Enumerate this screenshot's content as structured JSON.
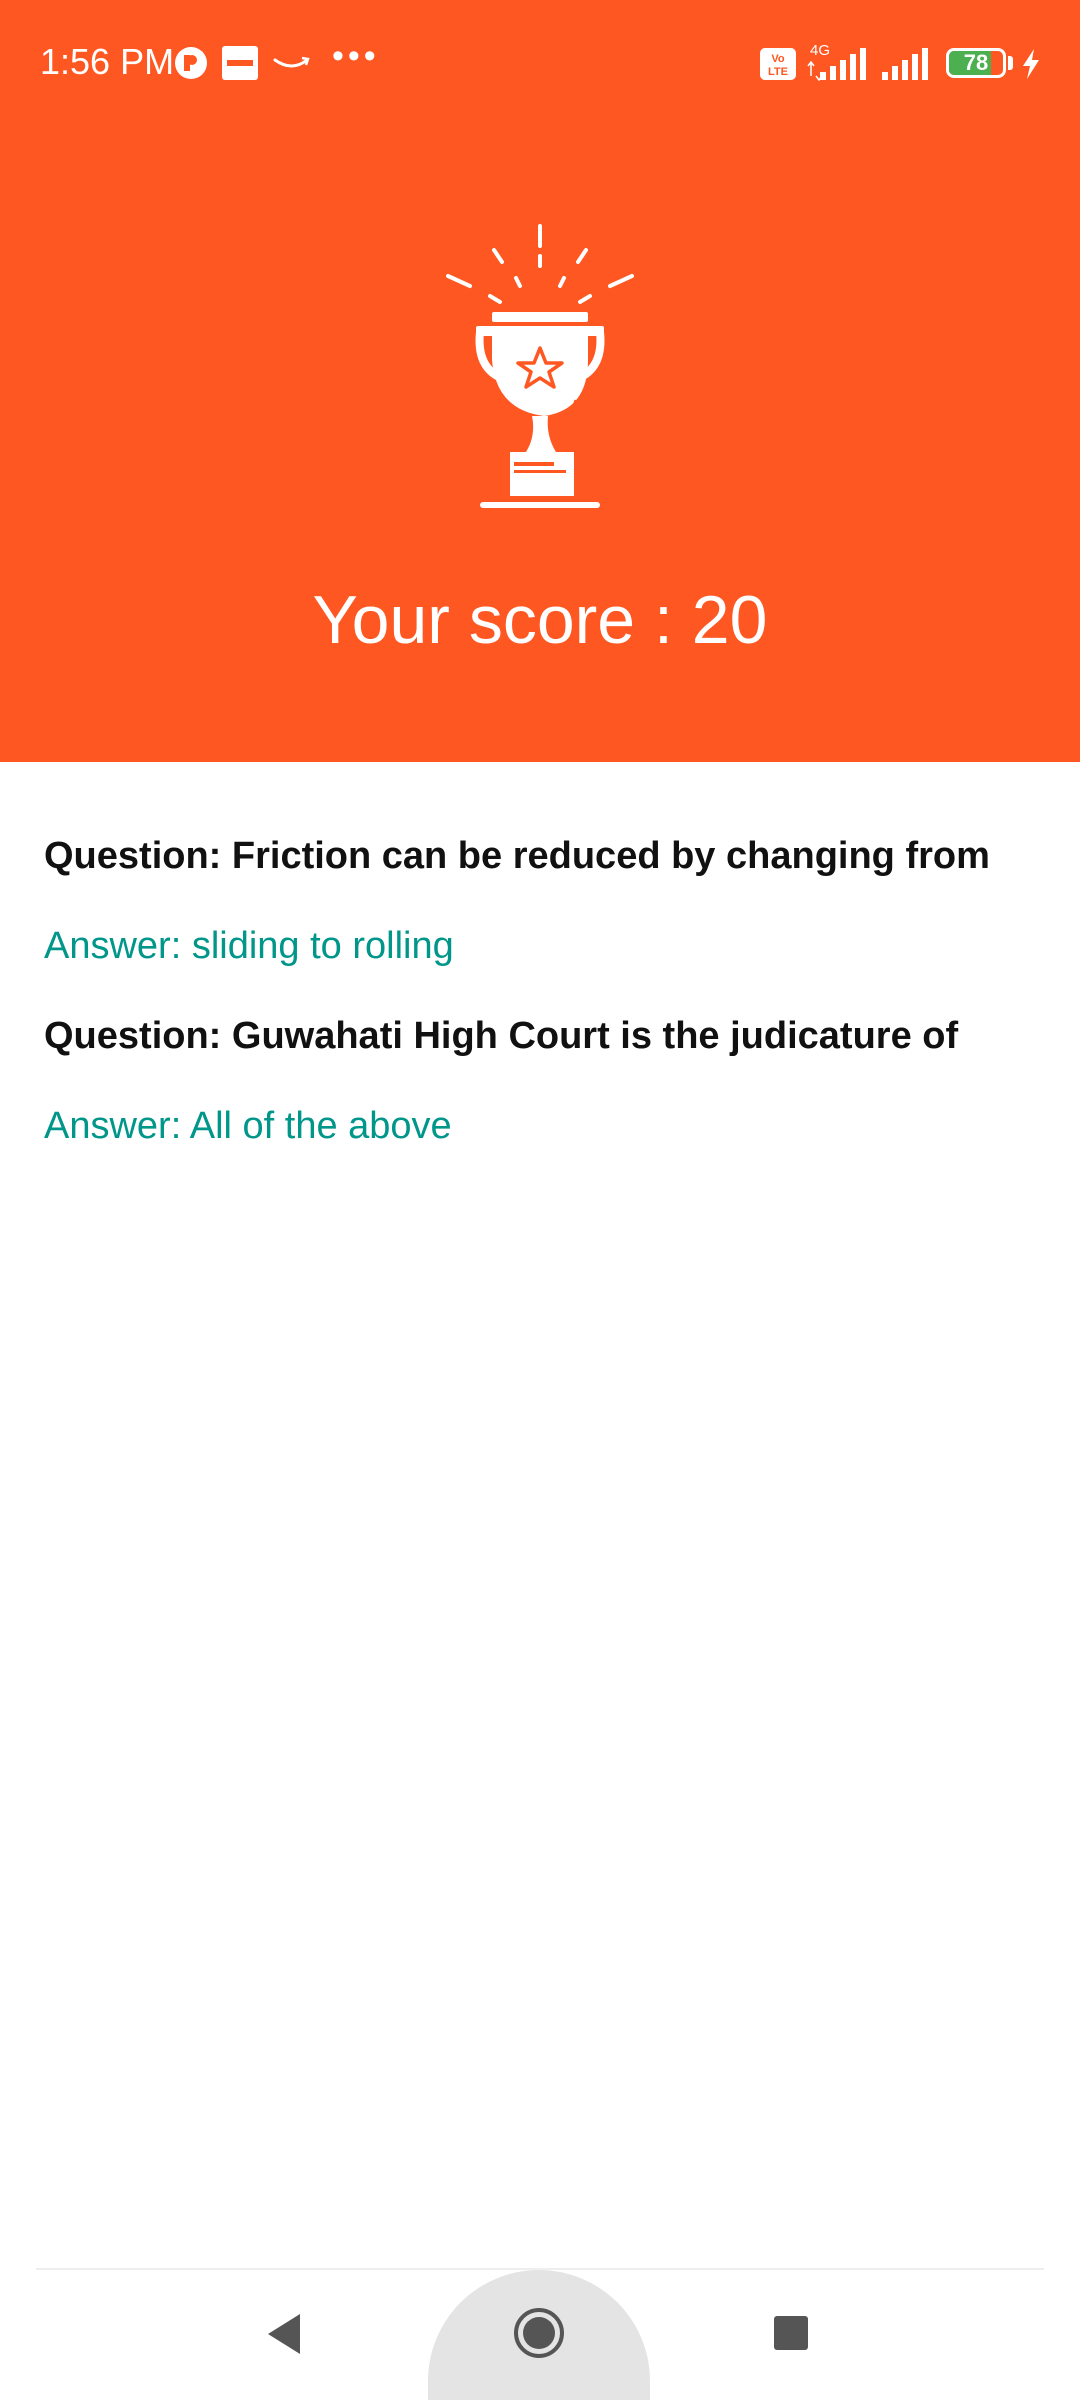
{
  "status_bar": {
    "time": "1:56 PM",
    "network_type": "4G",
    "volte": "Vo LTE",
    "battery_level": "78",
    "battery_fraction": 0.78,
    "icons": [
      "app-notification-icon",
      "zomato-notification-icon",
      "amazon-notification-icon",
      "more-notifications-icon",
      "volte-icon",
      "signal-icon",
      "signal-icon",
      "battery-icon",
      "charging-icon"
    ]
  },
  "header": {
    "background_color": "#FF5722",
    "trophy_icon": "trophy-icon",
    "score_text": "Your score : 20"
  },
  "results": [
    {
      "question": "Question: Friction can be reduced by changing from",
      "answer": "Answer: sliding to rolling"
    },
    {
      "question": "Question: Guwahati High Court is the judicature of",
      "answer": "Answer: All of the above"
    }
  ],
  "colors": {
    "accent": "#FF5722",
    "answer": "#00968A",
    "question": "#111111"
  },
  "nav": {
    "back_icon": "back-icon",
    "home_icon": "home-icon",
    "recents_icon": "recents-icon"
  }
}
